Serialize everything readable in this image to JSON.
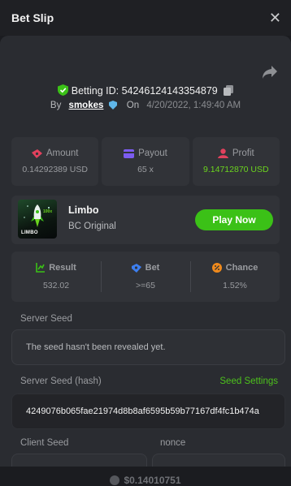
{
  "header": {
    "title": "Bet Slip"
  },
  "bet": {
    "id_label": "Betting ID: 54246124143354879",
    "by_label": "By",
    "user": "smokes",
    "on_label": "On",
    "date": "4/20/2022, 1:49:40 AM"
  },
  "stats": [
    {
      "label": "Amount",
      "value": "0.14292389 USD",
      "icon": "amount-icon"
    },
    {
      "label": "Payout",
      "value": "65 x",
      "icon": "payout-icon"
    },
    {
      "label": "Profit",
      "value": "9.14712870 USD",
      "icon": "profit-icon"
    }
  ],
  "game": {
    "name": "Limbo",
    "provider": "BC Original",
    "thumb_text": "LIMBO",
    "play_label": "Play Now"
  },
  "result": [
    {
      "label": "Result",
      "value": "532.02",
      "icon": "result-icon"
    },
    {
      "label": "Bet",
      "value": ">=65",
      "icon": "bet-icon"
    },
    {
      "label": "Chance",
      "value": "1.52%",
      "icon": "chance-icon"
    }
  ],
  "seeds": {
    "server_seed_label": "Server Seed",
    "server_seed_value": "The seed hasn't been revealed yet.",
    "server_hash_label": "Server Seed (hash)",
    "seed_settings_label": "Seed Settings",
    "server_hash_value": "4249076b065fae21974d8b8af6595b59b77167df4fc1b474a",
    "client_seed_label": "Client Seed",
    "nonce_label": "nonce"
  },
  "footer": {
    "balance": "$0.14010751"
  },
  "colors": {
    "accent_green": "#3bc117",
    "profit_green": "#6bd41e",
    "panel": "#2a2c31"
  }
}
